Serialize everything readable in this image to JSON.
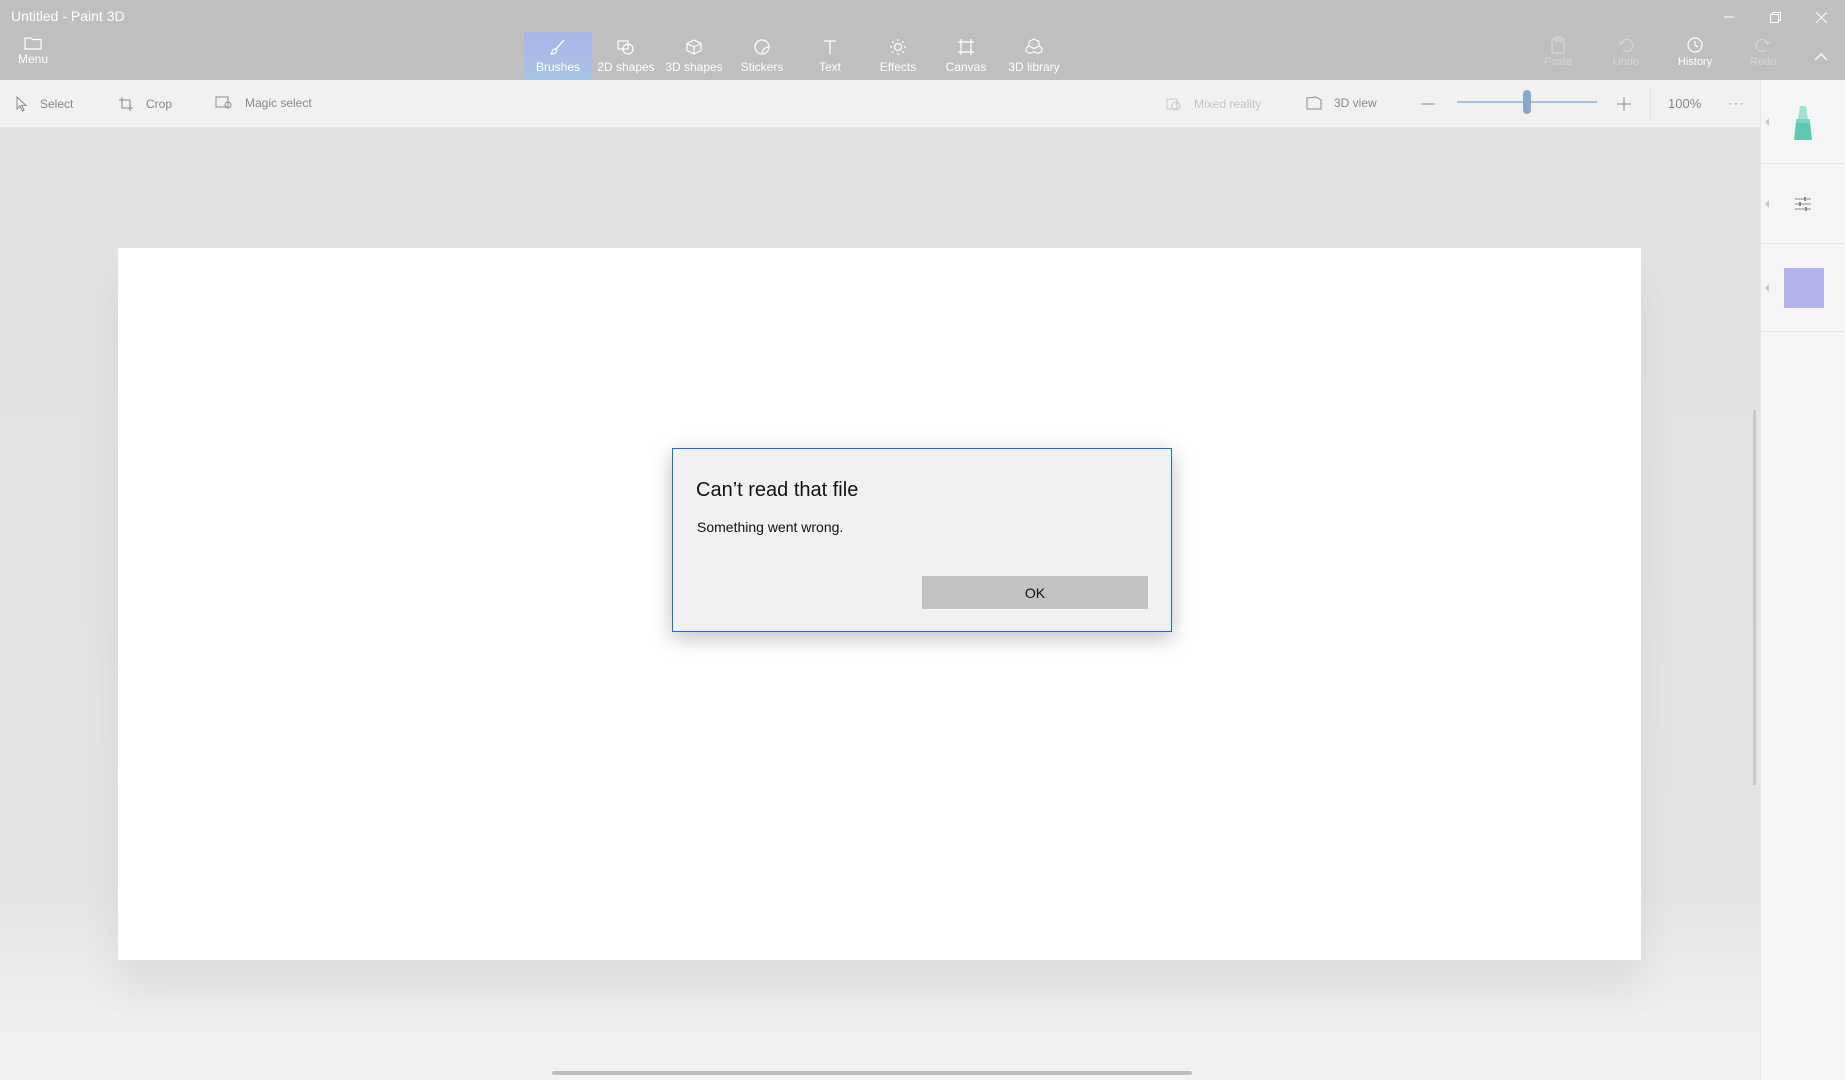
{
  "window": {
    "title": "Untitled - Paint 3D",
    "controls": [
      "minimize-icon",
      "restore-icon",
      "close-icon"
    ]
  },
  "ribbon": {
    "menu_label": "Menu",
    "tools": [
      {
        "label": "Brushes",
        "icon": "brush-icon",
        "active": true
      },
      {
        "label": "2D shapes",
        "icon": "2d-shapes-icon"
      },
      {
        "label": "3D shapes",
        "icon": "3d-shapes-icon"
      },
      {
        "label": "Stickers",
        "icon": "stickers-icon"
      },
      {
        "label": "Text",
        "icon": "text-icon"
      },
      {
        "label": "Effects",
        "icon": "effects-icon"
      },
      {
        "label": "Canvas",
        "icon": "canvas-icon"
      },
      {
        "label": "3D library",
        "icon": "3d-library-icon"
      }
    ],
    "right_tools": [
      {
        "label": "Paste",
        "icon": "paste-icon",
        "enabled": false
      },
      {
        "label": "Undo",
        "icon": "undo-icon",
        "enabled": false
      },
      {
        "label": "History",
        "icon": "history-icon",
        "enabled": true
      },
      {
        "label": "Redo",
        "icon": "redo-icon",
        "enabled": false
      }
    ]
  },
  "subbar": {
    "select_label": "Select",
    "crop_label": "Crop",
    "magic_select_label": "Magic select",
    "mixed_reality_label": "Mixed reality",
    "view_3d_label": "3D view",
    "zoom_percent": "100%",
    "zoom_level": 0.5
  },
  "sidepanel": {
    "swatch_color": "#b3b3ec",
    "brush_color": "#5fc8b2"
  },
  "dialog": {
    "title": "Can’t read that file",
    "message": "Something went wrong.",
    "ok_label": "OK"
  },
  "colors": {
    "ribbon_bg": "#bebfc1",
    "active_tool": "#a9b8e6",
    "dialog_border": "#1f6fbe"
  }
}
